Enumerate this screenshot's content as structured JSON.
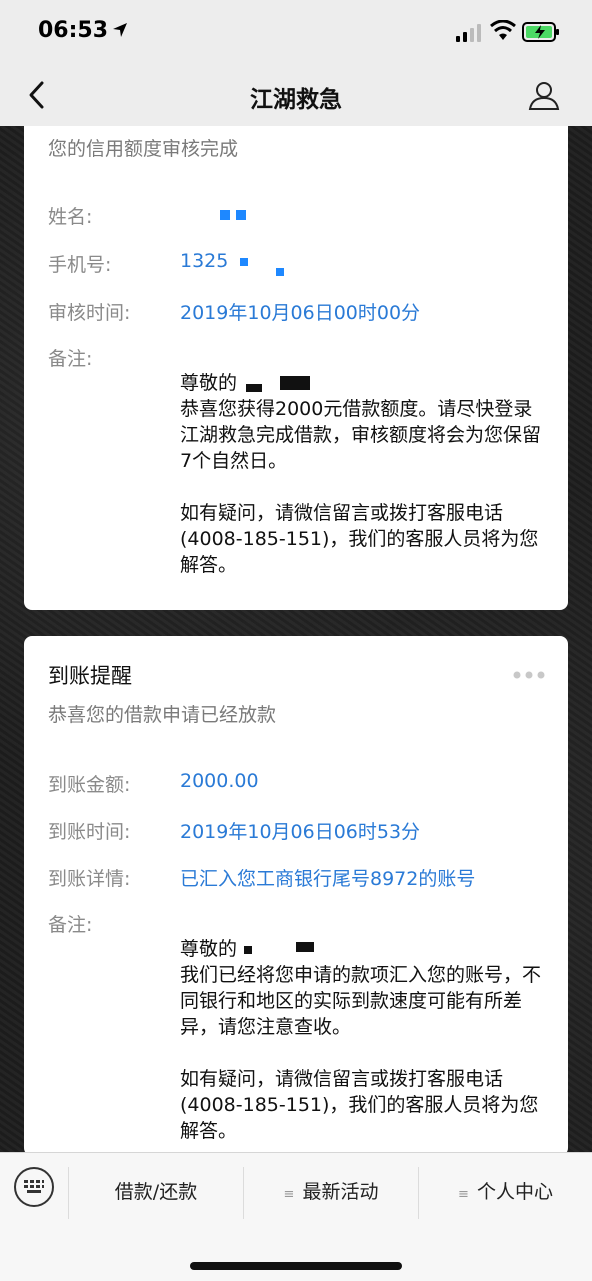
{
  "status": {
    "time": "06:53"
  },
  "nav": {
    "title": "江湖救急"
  },
  "card1": {
    "subtitle": "您的信用额度审核完成",
    "name_label": "姓名:",
    "phone_label": "手机号:",
    "phone_value": "1325",
    "review_time_label": "审核时间:",
    "review_time_value": "2019年10月06日00时00分",
    "note_label": "备注:",
    "note_greeting": "尊敬的",
    "note_body": "恭喜您获得2000元借款额度。请尽快登录江湖救急完成借款，审核额度将会为您保留7个自然日。",
    "note_contact": "如有疑问，请微信留言或拨打客服电话(4008-185-151)，我们的客服人员将为您解答。"
  },
  "card2": {
    "title": "到账提醒",
    "subtitle": "恭喜您的借款申请已经放款",
    "amount_label": "到账金额:",
    "amount_value": "2000.00",
    "time_label": "到账时间:",
    "time_value": "2019年10月06日06时53分",
    "detail_label": "到账详情:",
    "detail_value": "已汇入您工商银行尾号8972的账号",
    "note_label": "备注:",
    "note_greeting": "尊敬的",
    "note_body": "我们已经将您申请的款项汇入您的账号，不同银行和地区的实际到款速度可能有所差异，请您注意查收。",
    "note_contact": "如有疑问，请微信留言或拨打客服电话(4008-185-151)，我们的客服人员将为您解答。"
  },
  "bottom": {
    "tabs": [
      {
        "label": "借款/还款"
      },
      {
        "label": "最新活动"
      },
      {
        "label": "个人中心"
      }
    ]
  },
  "colors": {
    "link": "#2a7ad6",
    "bar": "#ededed"
  }
}
